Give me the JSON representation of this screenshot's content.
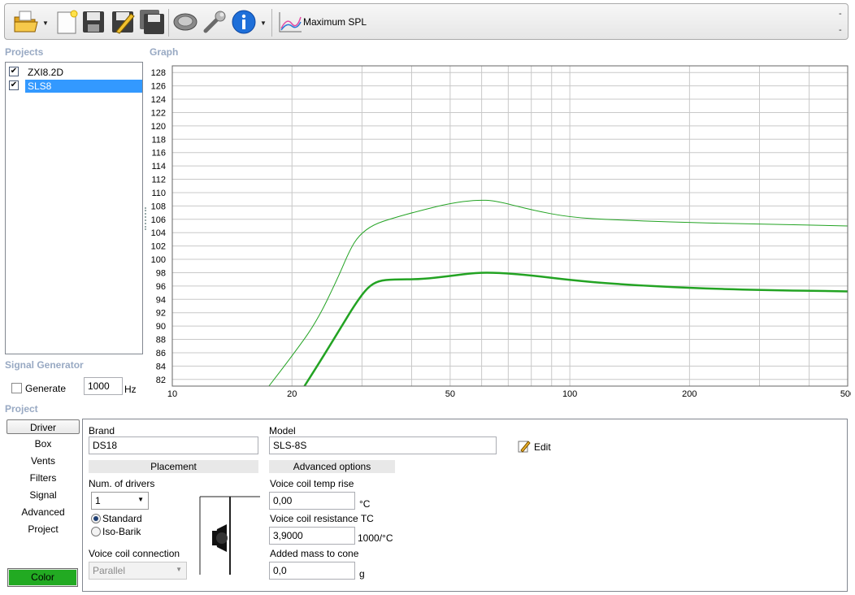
{
  "toolbar": {
    "buttons": [
      {
        "icon": "open-folder-icon",
        "has_dropdown": true
      },
      {
        "icon": "new-document-icon"
      },
      {
        "icon": "save-icon"
      },
      {
        "icon": "save-as-pencil-icon"
      },
      {
        "icon": "save-all-icon"
      },
      {
        "icon": "speaker-driver-icon"
      },
      {
        "icon": "wrench-icon"
      },
      {
        "icon": "info-icon",
        "has_dropdown": true
      },
      {
        "icon": "maximum-spl-graph-icon"
      }
    ],
    "mode_label": "Maximum SPL",
    "right_top": "-",
    "right_bottom": "-"
  },
  "projects": {
    "title": "Projects",
    "items": [
      {
        "name": "ZXI8.2D",
        "checked": true,
        "selected": false
      },
      {
        "name": "SLS8",
        "checked": true,
        "selected": true
      }
    ]
  },
  "signal_generator": {
    "title": "Signal Generator",
    "generate_label": "Generate",
    "generate_checked": false,
    "frequency": "1000",
    "unit": "Hz"
  },
  "graph": {
    "title": "Graph",
    "colors": {
      "line": "#23a323",
      "grid": "#c8c8c8"
    }
  },
  "chart_data": {
    "type": "line",
    "x_scale": "log",
    "xlim": [
      10,
      500
    ],
    "ylim": [
      81,
      129
    ],
    "x_ticks": [
      10,
      20,
      50,
      100,
      200,
      500
    ],
    "y_ticks": [
      82,
      84,
      86,
      88,
      90,
      92,
      94,
      96,
      98,
      100,
      102,
      104,
      106,
      108,
      110,
      112,
      114,
      116,
      118,
      120,
      122,
      124,
      126,
      128
    ],
    "grid": true,
    "series": [
      {
        "line_width": 1,
        "points": [
          [
            17.5,
            81
          ],
          [
            20,
            85.5
          ],
          [
            23,
            90.5
          ],
          [
            26,
            97
          ],
          [
            28,
            101.5
          ],
          [
            29.5,
            103.6
          ],
          [
            32,
            105.2
          ],
          [
            36,
            106.2
          ],
          [
            42,
            107.3
          ],
          [
            50,
            108.4
          ],
          [
            58,
            108.9
          ],
          [
            65,
            108.8
          ],
          [
            80,
            107.4
          ],
          [
            100,
            106.3
          ],
          [
            130,
            105.9
          ],
          [
            200,
            105.5
          ],
          [
            300,
            105.3
          ],
          [
            500,
            105.0
          ]
        ]
      },
      {
        "line_width": 2.5,
        "points": [
          [
            21.5,
            81
          ],
          [
            24,
            85.5
          ],
          [
            27,
            90.5
          ],
          [
            29,
            93.5
          ],
          [
            31,
            95.8
          ],
          [
            33,
            96.8
          ],
          [
            36,
            97.0
          ],
          [
            42,
            97.0
          ],
          [
            50,
            97.5
          ],
          [
            58,
            98.0
          ],
          [
            66,
            98.0
          ],
          [
            80,
            97.6
          ],
          [
            100,
            96.9
          ],
          [
            130,
            96.3
          ],
          [
            200,
            95.7
          ],
          [
            300,
            95.4
          ],
          [
            500,
            95.2
          ]
        ]
      }
    ]
  },
  "project": {
    "title": "Project",
    "tabs": [
      "Driver",
      "Box",
      "Vents",
      "Filters",
      "Signal",
      "Advanced",
      "Project"
    ],
    "active_tab": "Driver",
    "color_button": "Color",
    "color_value": "#22aa22"
  },
  "driver": {
    "brand_label": "Brand",
    "brand_value": "DS18",
    "model_label": "Model",
    "model_value": "SLS-8S",
    "edit_label": "Edit",
    "placement_header": "Placement",
    "num_drivers_label": "Num. of drivers",
    "num_drivers_value": "1",
    "standard_label": "Standard",
    "isobarik_label": "Iso-Barik",
    "placement_selected": "Standard",
    "coil_connection_label": "Voice coil connection",
    "coil_connection_value": "Parallel",
    "advanced_header": "Advanced options",
    "vc_temp_label": "Voice coil temp rise",
    "vc_temp_value": "0,00",
    "vc_temp_unit": "°C",
    "vc_res_label": "Voice coil resistance TC",
    "vc_res_value": "3,9000",
    "vc_res_unit": "1000/°C",
    "added_mass_label": "Added mass to cone",
    "added_mass_value": "0,0",
    "added_mass_unit": "g"
  }
}
